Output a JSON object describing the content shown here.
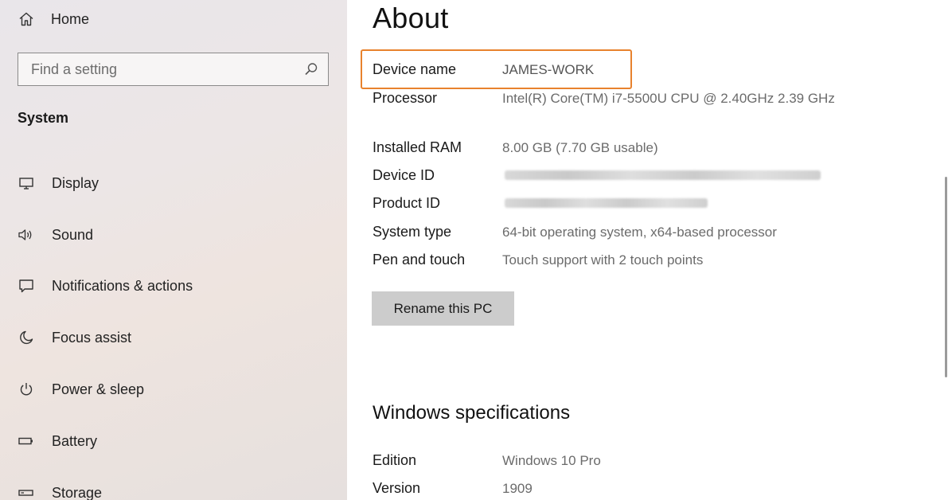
{
  "sidebar": {
    "home": {
      "label": "Home",
      "icon": "home-icon"
    },
    "search": {
      "placeholder": "Find a setting",
      "icon": "search-icon"
    },
    "section_title": "System",
    "items": [
      {
        "label": "Display",
        "icon": "monitor-icon"
      },
      {
        "label": "Sound",
        "icon": "speaker-icon"
      },
      {
        "label": "Notifications & actions",
        "icon": "notification-icon"
      },
      {
        "label": "Focus assist",
        "icon": "moon-icon"
      },
      {
        "label": "Power & sleep",
        "icon": "power-icon"
      },
      {
        "label": "Battery",
        "icon": "battery-icon"
      },
      {
        "label": "Storage",
        "icon": "storage-icon"
      }
    ]
  },
  "main": {
    "title": "About",
    "device_specs": {
      "device_name": {
        "label": "Device name",
        "value": "JAMES-WORK"
      },
      "processor": {
        "label": "Processor",
        "value": "Intel(R) Core(TM) i7-5500U CPU @ 2.40GHz   2.39 GHz"
      },
      "installed_ram": {
        "label": "Installed RAM",
        "value": "8.00 GB (7.70 GB usable)"
      },
      "device_id": {
        "label": "Device ID",
        "value_redacted": true
      },
      "product_id": {
        "label": "Product ID",
        "value_redacted": true
      },
      "system_type": {
        "label": "System type",
        "value": "64-bit operating system, x64-based processor"
      },
      "pen_and_touch": {
        "label": "Pen and touch",
        "value": "Touch support with 2 touch points"
      }
    },
    "rename_button": "Rename this PC",
    "windows_specs": {
      "heading": "Windows specifications",
      "edition": {
        "label": "Edition",
        "value": "Windows 10 Pro"
      },
      "version": {
        "label": "Version",
        "value": "1909"
      }
    }
  },
  "colors": {
    "highlight": "#e8822d",
    "button_bg": "#cccccc"
  }
}
